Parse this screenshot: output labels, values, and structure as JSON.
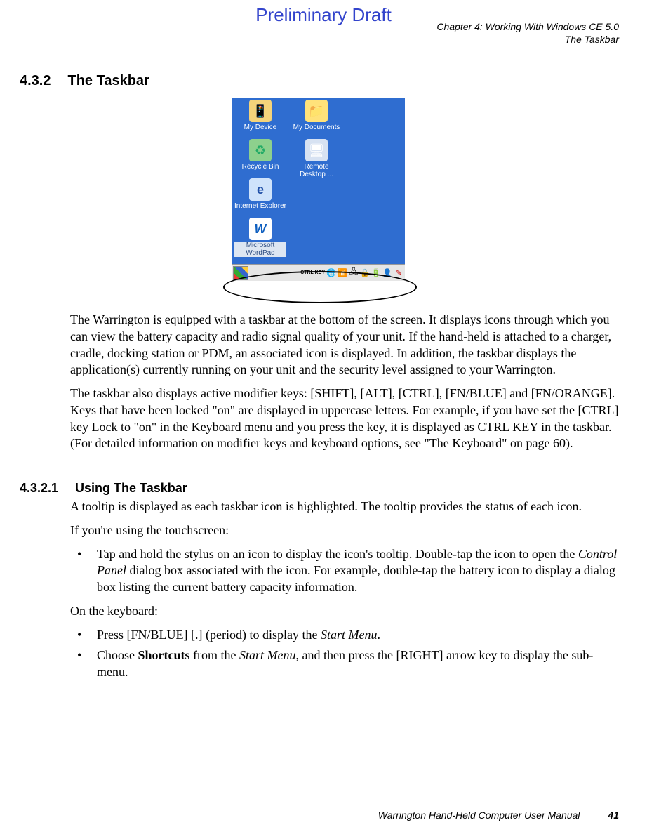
{
  "preliminary": "Preliminary Draft",
  "header": {
    "line1": "Chapter 4:  Working With Windows CE 5.0",
    "line2": "The Taskbar"
  },
  "section432": {
    "num": "4.3.2",
    "title": "The Taskbar"
  },
  "section4321": {
    "num": "4.3.2.1",
    "title": "Using The Taskbar"
  },
  "desktop": {
    "my_device": "My Device",
    "my_documents": "My Documents",
    "recycle_bin": "Recycle Bin",
    "remote_desktop": "Remote Desktop ...",
    "internet_explorer": "Internet Explorer",
    "wordpad": "Microsoft WordPad",
    "ctrl_key": "CTRL KEY"
  },
  "para1": "The Warrington is equipped with a taskbar at the bottom of the screen. It displays icons through which you can view the battery capacity and radio signal quality of your unit. If the hand-held is attached to a charger, cradle, docking station or PDM, an associated icon is displayed. In addition, the taskbar displays the application(s) currently running on your unit and the security level assigned to your Warrington.",
  "para2": "The taskbar also displays active modifier keys: [SHIFT], [ALT], [CTRL], [FN/BLUE] and [FN/ORANGE]. Keys that have been locked \"on\" are displayed in uppercase letters. For example, if you have set the [CTRL] key Lock to \"on\" in the Keyboard menu and you press the key, it is displayed as CTRL KEY in the taskbar. (For detailed information on modifier keys and keyboard options, see \"The Keyboard\" on page 60).",
  "para3": "A tooltip is displayed as each taskbar icon is highlighted. The tooltip provides the status of each icon.",
  "para4": "If you're using the touchscreen:",
  "bullet1a": "Tap and hold the stylus on an icon to display the icon's tooltip. Double-tap the icon to open the ",
  "bullet1_cp": "Control Panel",
  "bullet1b": " dialog box associated with the icon. For example, double-tap the battery icon to display a dialog box listing the current battery capacity information.",
  "para5": "On the keyboard:",
  "bullet2a": "Press [FN/BLUE] [.] (period) to display the ",
  "bullet2_sm": "Start Menu",
  "bullet2b": ".",
  "bullet3a": "Choose ",
  "bullet3_sc": "Shortcuts",
  "bullet3b": " from the ",
  "bullet3_sm": "Start Menu",
  "bullet3c": ", and then press the [RIGHT] arrow key to display the sub-menu.",
  "footer": {
    "title": "Warrington Hand-Held Computer User Manual",
    "page": "41"
  }
}
